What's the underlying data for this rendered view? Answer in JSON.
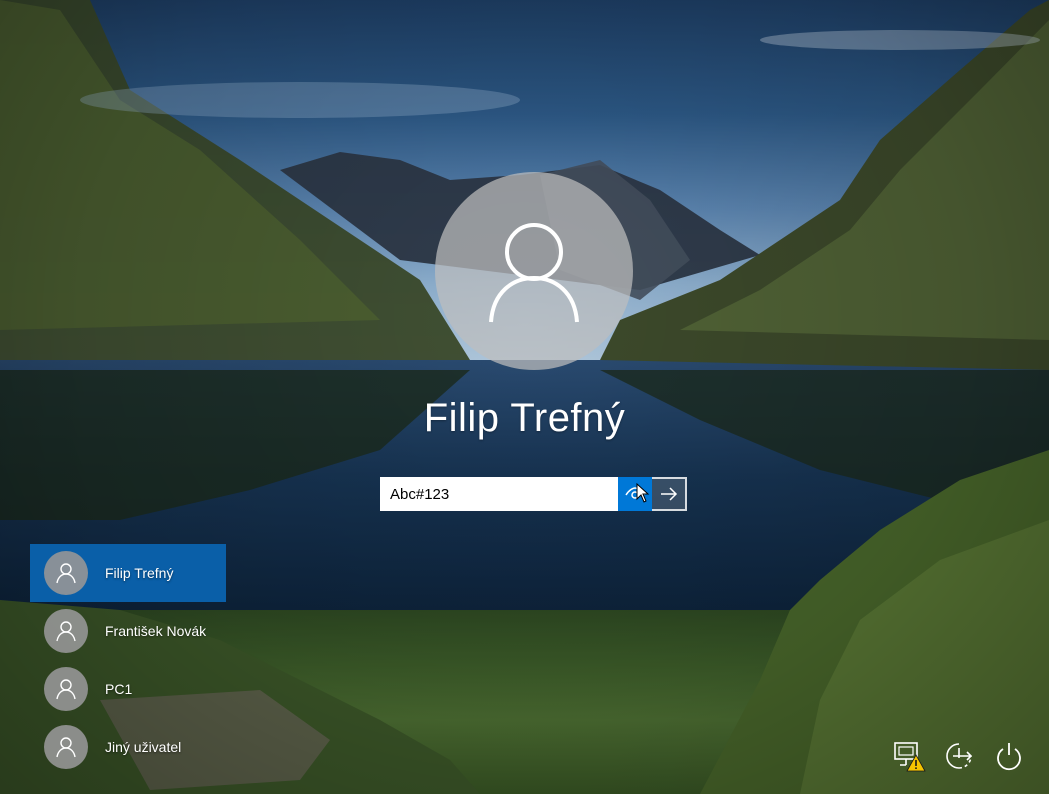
{
  "login": {
    "selected_user": "Filip Trefný",
    "password_value": "Abc#123",
    "icons": {
      "avatar": "user-icon",
      "reveal": "eye-icon",
      "submit": "arrow-right-icon"
    }
  },
  "users": [
    {
      "name": "Filip Trefný",
      "active": true
    },
    {
      "name": "František Novák",
      "active": false
    },
    {
      "name": "PC1",
      "active": false
    },
    {
      "name": "Jiný uživatel",
      "active": false
    }
  ],
  "tray": {
    "network": "network-warning-icon",
    "accessibility": "ease-of-access-icon",
    "power": "power-icon"
  },
  "colors": {
    "accent": "#0078d7",
    "selected_user_bg": "#0a5fa8"
  }
}
